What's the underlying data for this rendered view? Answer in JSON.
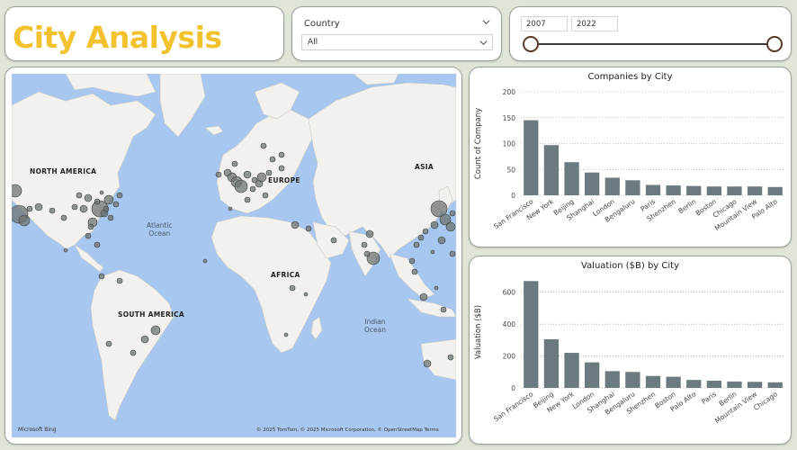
{
  "header": {
    "title": "City Analysis"
  },
  "filters": {
    "country_label": "Country",
    "country_value": "All",
    "year_start": "2007",
    "year_end": "2022"
  },
  "map": {
    "labels": {
      "north_america": "NORTH AMERICA",
      "europe": "EUROPE",
      "asia": "ASIA",
      "africa": "AFRICA",
      "south_america": "SOUTH AMERICA"
    },
    "oceans": {
      "atlantic": "Atlantic\nOcean",
      "indian": "Indian\nOcean"
    },
    "attribution": "© 2025 TomTom, © 2025 Microsoft Corporation, © OpenStreetMap  Terms",
    "provider": "Microsoft Bing"
  },
  "colors": {
    "accent_title": "#f2c12e",
    "bar": "#6b7a7e",
    "ocean": "#a7c7f0",
    "land": "#f2f1ed",
    "bubble": "#6e7470"
  },
  "chart_data": [
    {
      "type": "bar",
      "title": "Companies by City",
      "xlabel": "",
      "ylabel": "Count of Company",
      "ylim": [
        0,
        200
      ],
      "yticks": [
        0,
        50,
        100,
        150,
        200
      ],
      "categories": [
        "San Francisco",
        "New York",
        "Beijing",
        "Shanghai",
        "London",
        "Bengaluru",
        "Paris",
        "Shenzhen",
        "Berlin",
        "Boston",
        "Chicago",
        "Mountain View",
        "Palo Alto"
      ],
      "values": [
        145,
        97,
        64,
        44,
        34,
        29,
        20,
        19,
        18,
        17,
        17,
        17,
        16
      ],
      "grid": true
    },
    {
      "type": "bar",
      "title": "Valuation ($B) by City",
      "xlabel": "",
      "ylabel": "Valuation ($B)",
      "ylim": [
        0,
        700
      ],
      "yticks": [
        0,
        200,
        400,
        600
      ],
      "categories": [
        "San Francisco",
        "Beijing",
        "New York",
        "London",
        "Shanghai",
        "Bengaluru",
        "Shenzhen",
        "Boston",
        "Palo Alto",
        "Paris",
        "Berlin",
        "Mountain View",
        "Chicago"
      ],
      "values": [
        670,
        305,
        220,
        160,
        105,
        100,
        75,
        70,
        50,
        45,
        40,
        38,
        35
      ],
      "grid": true
    }
  ]
}
